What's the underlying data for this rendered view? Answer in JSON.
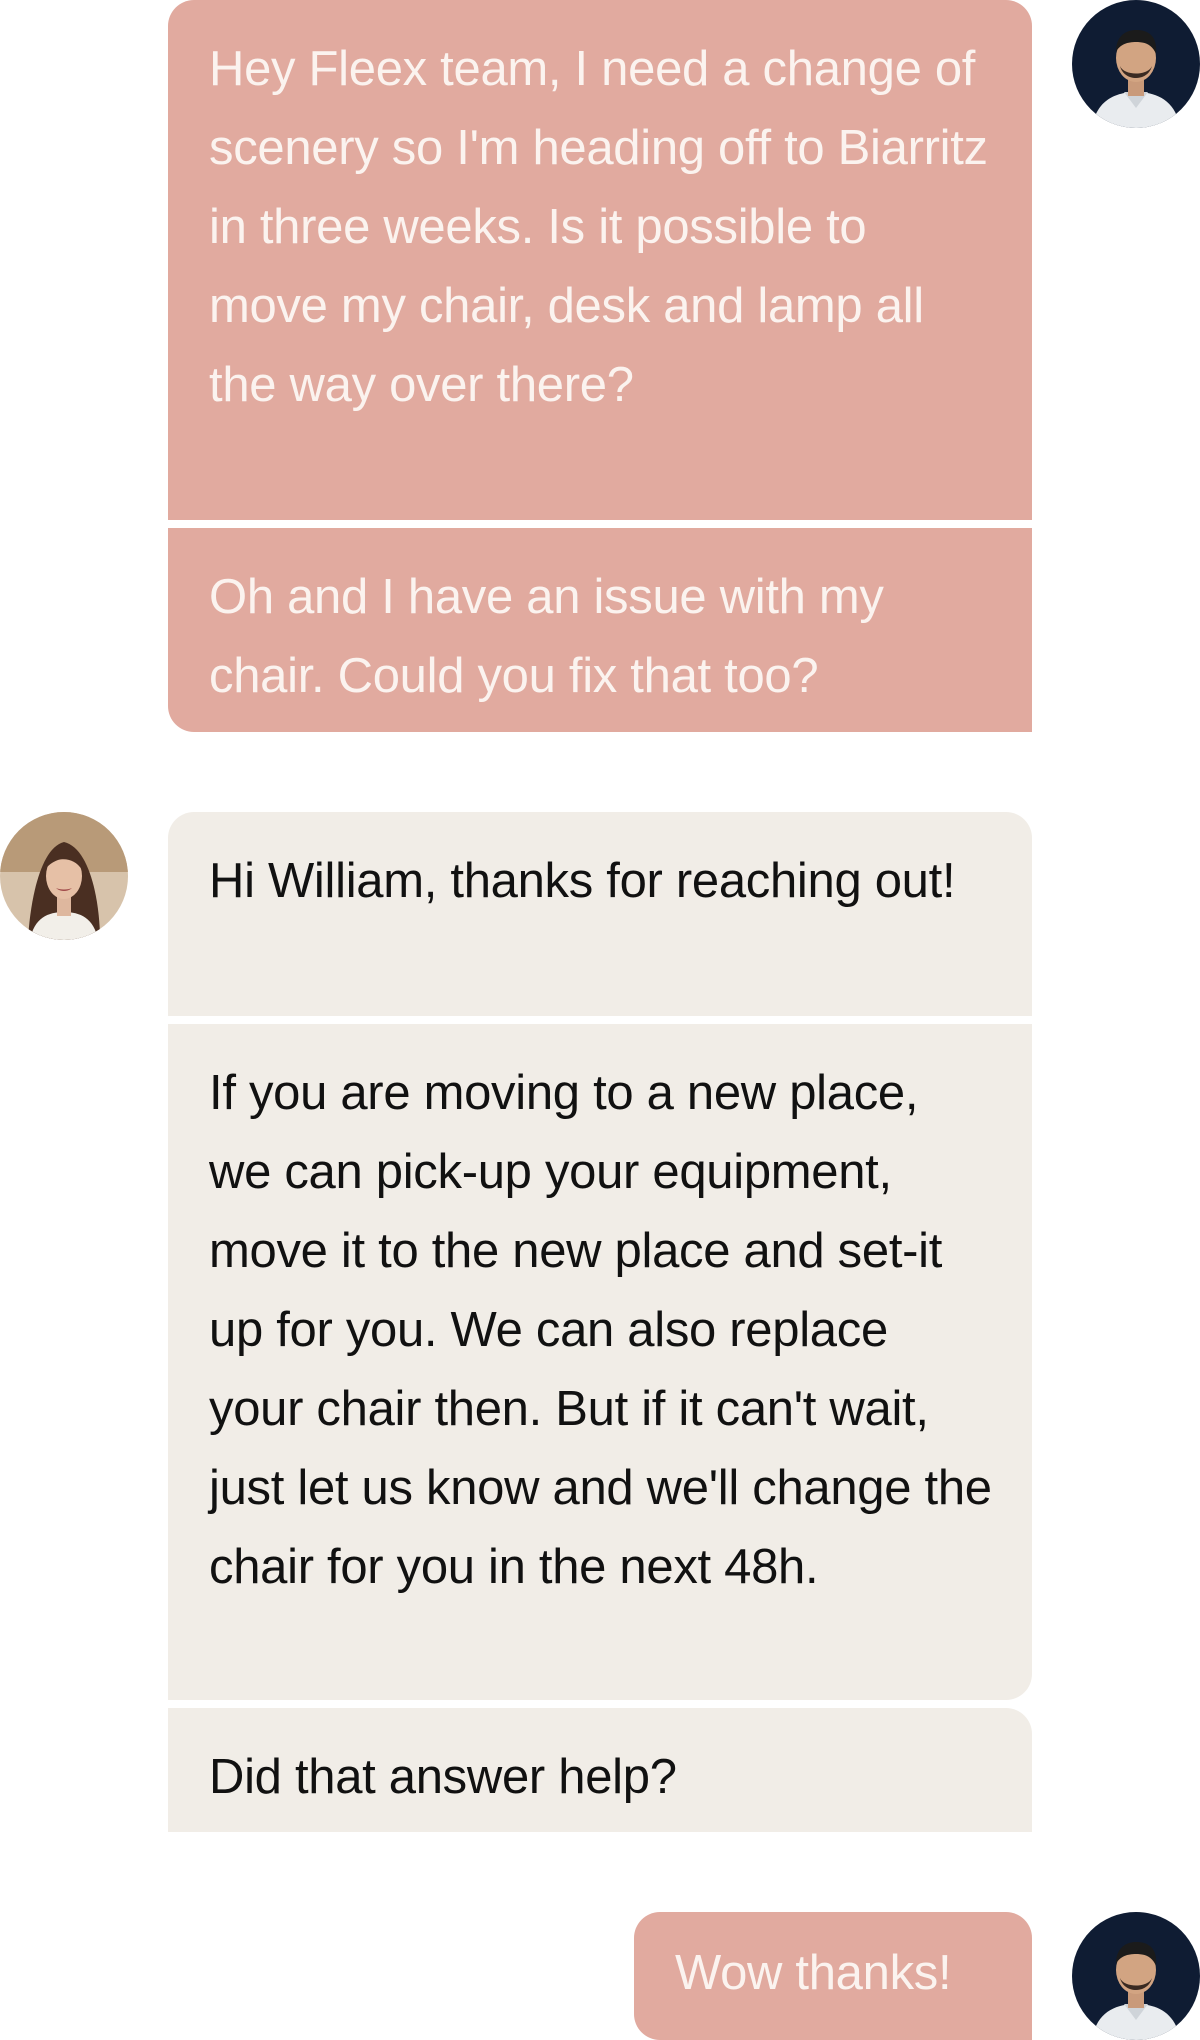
{
  "conversation": {
    "user_name": "William",
    "messages": [
      {
        "from": "user",
        "text": "Hey Fleex team, I need a change of scenery so I'm heading off to Biarritz in three weeks. Is it possible to move my chair, desk and lamp all the way over there?"
      },
      {
        "from": "user",
        "text": "Oh and I have an issue with my chair. Could you fix that too?"
      },
      {
        "from": "agent",
        "text": "Hi William, thanks for reaching out!"
      },
      {
        "from": "agent",
        "text": "If you are moving to a new place, we can pick-up your equipment, move it to the new place and set-it up for you. We can also replace your chair then. But if it can't wait, just let us know and we'll change the chair for you in the next 48h."
      },
      {
        "from": "agent",
        "text": "Did that answer help?"
      },
      {
        "from": "user",
        "text": "Wow thanks!"
      }
    ]
  },
  "colors": {
    "user_bubble": "#e1aa9f",
    "user_text": "#fbf3ef",
    "agent_bubble": "#f1ede7",
    "agent_text": "#111111",
    "user_avatar_bg": "#0f1c33"
  },
  "icons": {
    "user_avatar": "user-avatar-icon",
    "agent_avatar": "agent-avatar-icon"
  }
}
